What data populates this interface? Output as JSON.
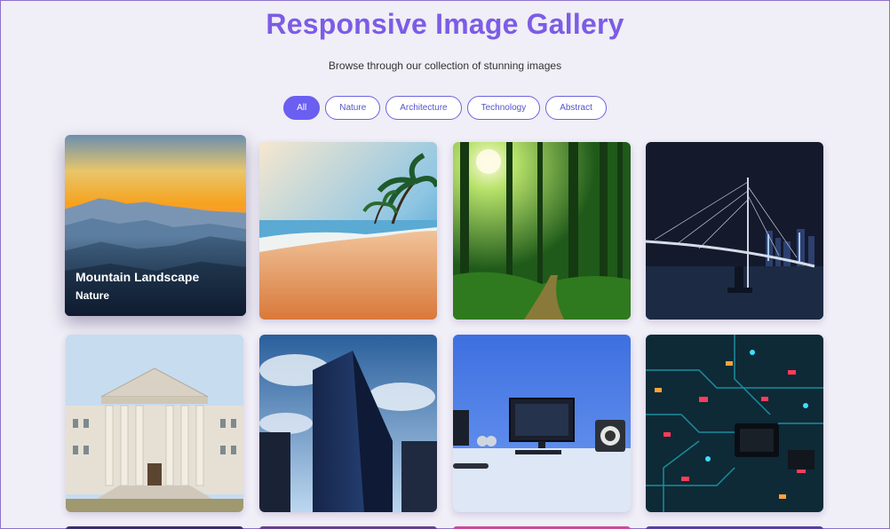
{
  "page": {
    "title": "Responsive Image Gallery",
    "subtitle": "Browse through our collection of stunning images"
  },
  "filters": [
    {
      "label": "All",
      "active": true
    },
    {
      "label": "Nature",
      "active": false
    },
    {
      "label": "Architecture",
      "active": false
    },
    {
      "label": "Technology",
      "active": false
    },
    {
      "label": "Abstract",
      "active": false
    }
  ],
  "gallery": {
    "items": [
      {
        "title": "Mountain Landscape",
        "category": "Nature",
        "image": "mountain-sunset",
        "caption_visible": true
      },
      {
        "image": "tropical-beach"
      },
      {
        "image": "sunlit-forest"
      },
      {
        "image": "night-bridge-city"
      },
      {
        "image": "classical-building"
      },
      {
        "image": "glass-skyscraper"
      },
      {
        "image": "desk-computer-setup"
      },
      {
        "image": "circuit-board"
      }
    ]
  },
  "colors": {
    "accent": "#7c5ce6",
    "button_active": "#6a5ff0",
    "background": "#f0eef6"
  }
}
